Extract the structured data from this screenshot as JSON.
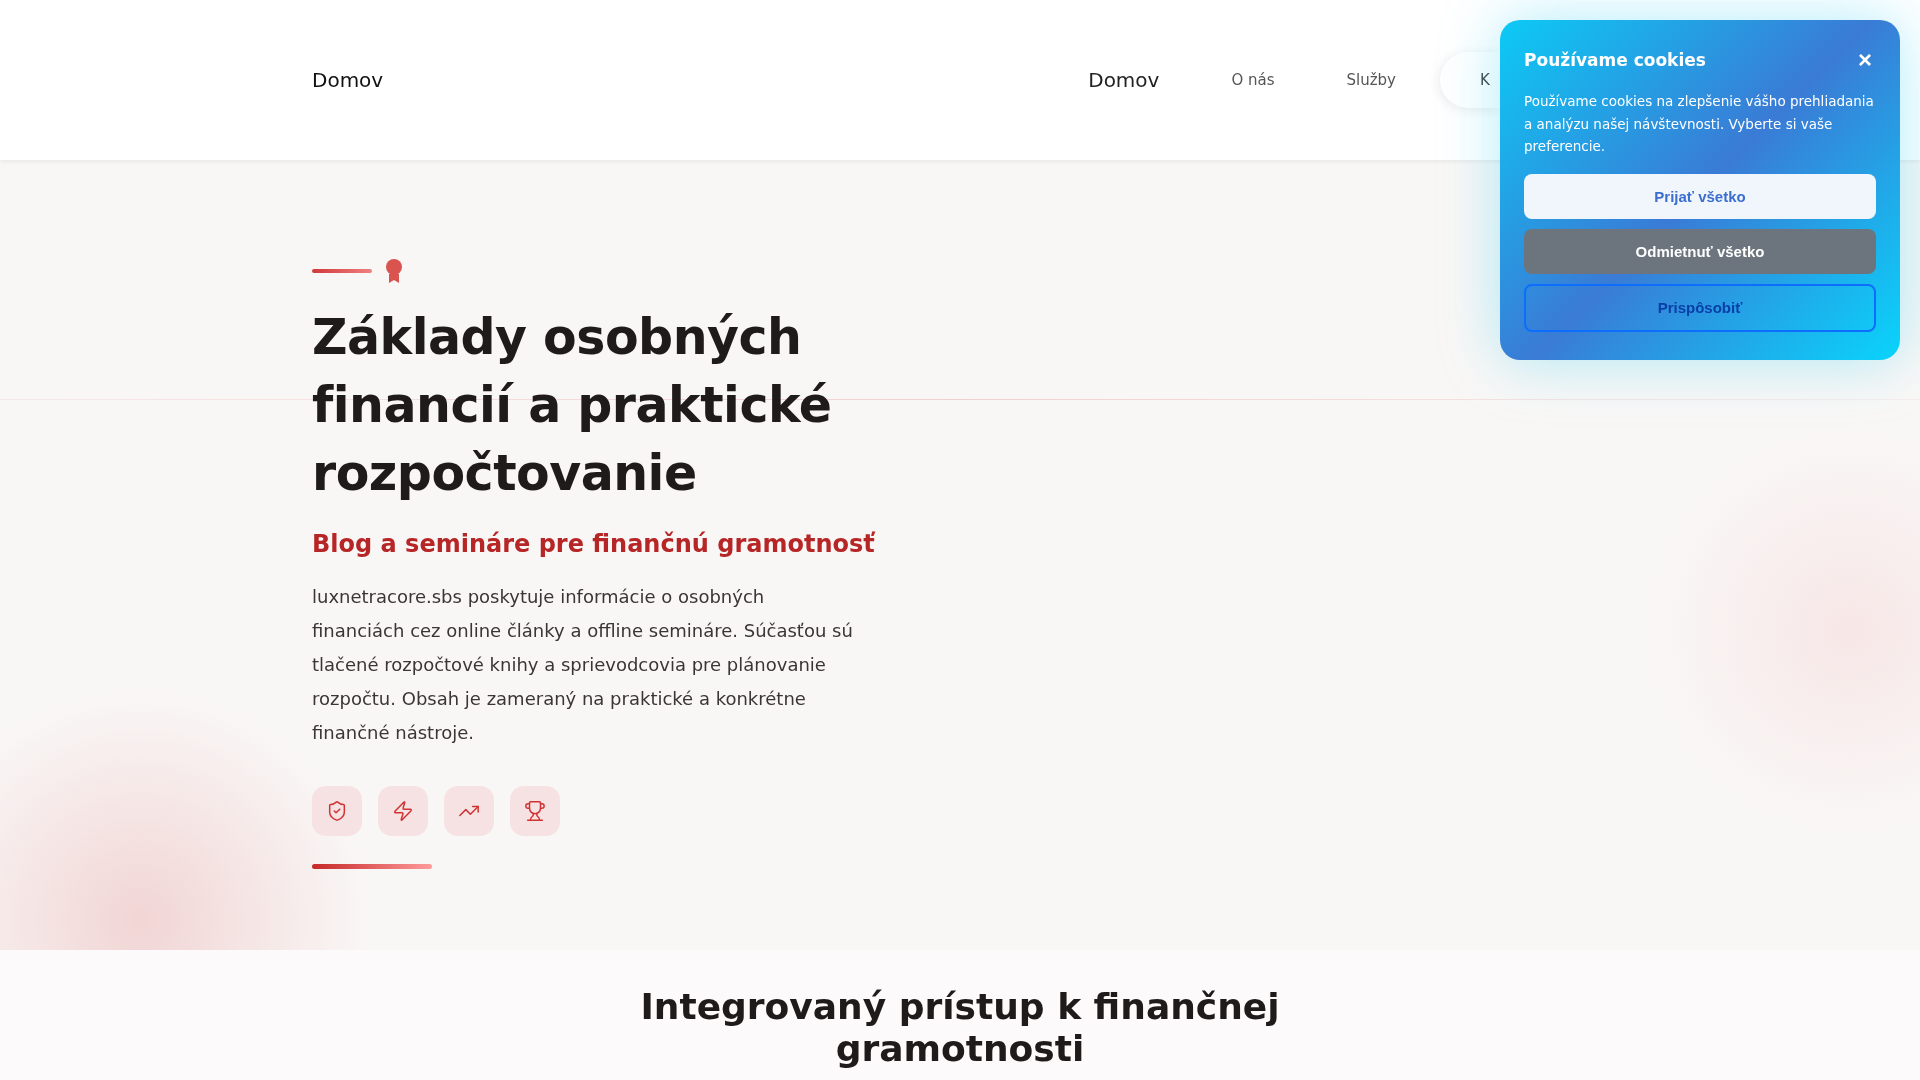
{
  "header": {
    "logo": "Domov",
    "nav": [
      {
        "label": "Domov",
        "selected": true
      },
      {
        "label": "O nás",
        "selected": false
      },
      {
        "label": "Služby",
        "selected": false
      }
    ],
    "nav_button": "K"
  },
  "cookie_banner": {
    "title": "Používame cookies",
    "close": "×",
    "text": "Používame cookies na zlepšenie vášho prehliadania a analýzu našej návštevnosti. Vyberte si vaše preferencie.",
    "buttons": [
      {
        "label": "Prijať všetko",
        "kind": "accept"
      },
      {
        "label": "Odmietnuť všetko",
        "kind": "reject"
      },
      {
        "label": "Prispôsobiť",
        "kind": "customize"
      }
    ]
  },
  "hero": {
    "title": "Základy osobných financií a praktické rozpočtovanie",
    "subtitle": "Blog a semináre pre finančnú gramotnosť",
    "text": "luxnetracore.sbs poskytuje informácie o osobných financiách cez online články a offline semináre. Súčasťou sú tlačené rozpočtové knihy a sprievodcovia pre plánovanie rozpočtu. Obsah je zameraný na praktické a konkrétne finančné nástroje.",
    "features": [
      {
        "kind": "shield"
      },
      {
        "kind": "bolt"
      },
      {
        "kind": "chart"
      },
      {
        "kind": "trophy"
      }
    ]
  },
  "section": {
    "title": "Integrovaný prístup k finančnej gramotnosti"
  }
}
